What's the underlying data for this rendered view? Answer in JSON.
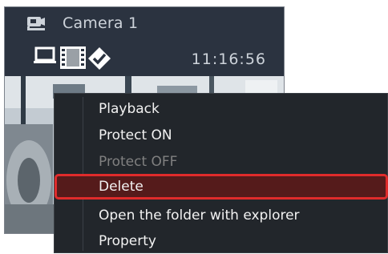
{
  "camera": {
    "name": "Camera 1",
    "time": "11:16:56",
    "status_icons": [
      "laptop-icon",
      "film-icon",
      "protected-check-icon"
    ]
  },
  "context_menu": {
    "items": [
      {
        "label": "Playback",
        "enabled": true
      },
      {
        "label": "Protect ON",
        "enabled": true
      },
      {
        "label": "Protect OFF",
        "enabled": false
      },
      {
        "label": "Delete",
        "enabled": true,
        "highlighted": true
      },
      {
        "label": "Open the folder with explorer",
        "enabled": true
      },
      {
        "label": "Property",
        "enabled": true
      }
    ]
  },
  "colors": {
    "tile_background": "#2b3340",
    "menu_background": "#22262b",
    "highlight_fill": "#551b1b",
    "highlight_border": "#e02b2b",
    "disabled_text": "#808080"
  }
}
